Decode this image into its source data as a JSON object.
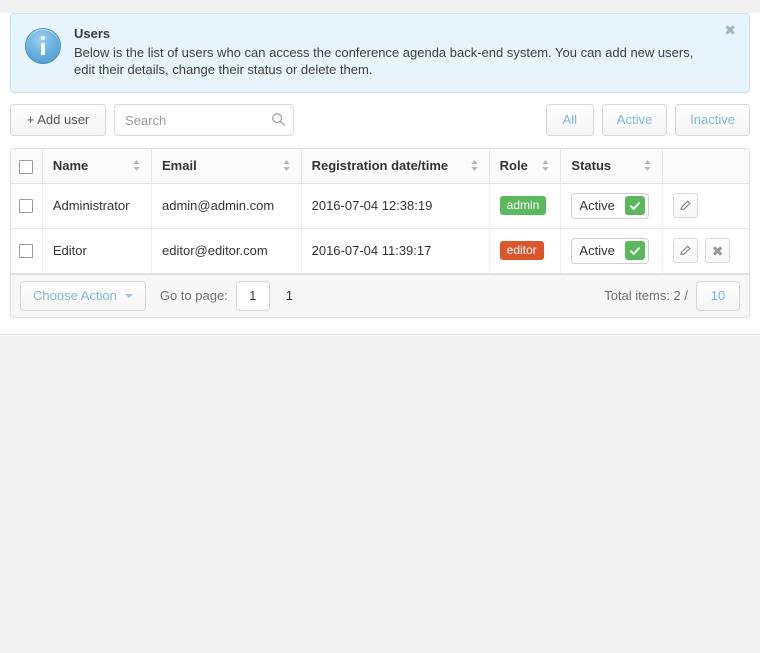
{
  "alert": {
    "icon": "info-icon",
    "title": "Users",
    "text": "Below is the list of users who can access the conference agenda back-end system. You can add new users, edit their details, change their status or delete them.",
    "close_label": "✖"
  },
  "toolbar": {
    "add_user_label": "+ Add user",
    "search_placeholder": "Search",
    "search_value": "",
    "search_icon": "search-icon",
    "filters": [
      {
        "label": "All"
      },
      {
        "label": "Active"
      },
      {
        "label": "Inactive"
      }
    ]
  },
  "table": {
    "columns": [
      {
        "label": "Name",
        "sortable": true
      },
      {
        "label": "Email",
        "sortable": true
      },
      {
        "label": "Registration date/time",
        "sortable": true
      },
      {
        "label": "Role",
        "sortable": true
      },
      {
        "label": "Status",
        "sortable": true
      },
      {
        "label": "",
        "sortable": false
      }
    ],
    "rows": [
      {
        "name": "Administrator",
        "email": "admin@admin.com",
        "registration": "2016-07-04 12:38:19",
        "role": "admin",
        "role_color": "#5cb85c",
        "status": "Active",
        "status_icon": "check-icon",
        "edit_label": "edit-icon",
        "delete_label": ""
      },
      {
        "name": "Editor",
        "email": "editor@editor.com",
        "registration": "2016-07-04 11:39:17",
        "role": "editor",
        "role_color": "#d9572b",
        "status": "Active",
        "status_icon": "check-icon",
        "edit_label": "edit-icon",
        "delete_label": "✖"
      }
    ]
  },
  "footer": {
    "choose_action_label": "Choose Action",
    "goto_label": "Go to page:",
    "page_value": "1",
    "page_number": "1",
    "total_label": "Total items: 2 /",
    "per_page_label": "10"
  },
  "colors": {
    "accent": "#7fb6dd",
    "success": "#5cb85c",
    "warning": "#d9572b",
    "alert_bg": "#e8f4fb",
    "alert_border": "#c8e2f0"
  }
}
